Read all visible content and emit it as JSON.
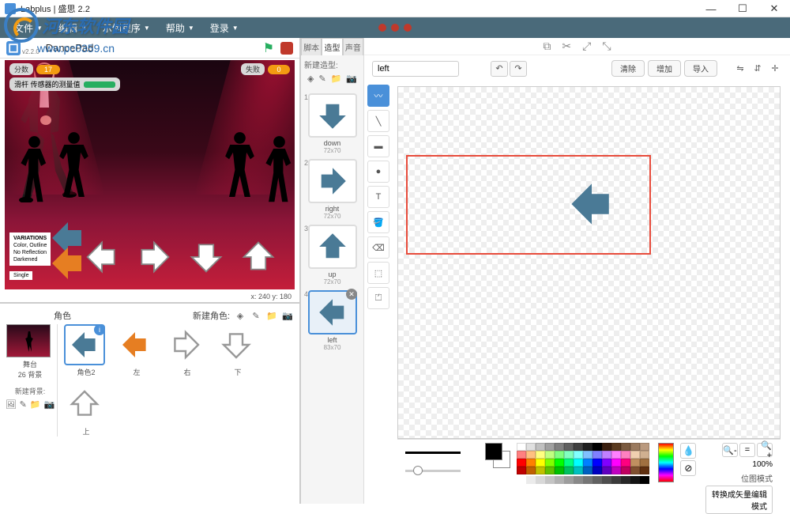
{
  "window": {
    "title": "Labplus | 盛思 2.2"
  },
  "watermark": {
    "text": "河东软件园",
    "url": "www.pc0359.cn"
  },
  "menubar": {
    "items": [
      "文件",
      "编辑",
      "示例程序",
      "帮助",
      "登录"
    ]
  },
  "stage": {
    "version": "v2.2.0",
    "project_name": "DancePad",
    "score_label": "分数",
    "score_value": "17",
    "fail_label": "失败",
    "fail_value": "0",
    "monitor_label": "滑杆 传感器的测量值",
    "variations_title": "VARIATIONS",
    "variations_lines": "Color, Outline\nNo Reflection\nDarkened",
    "single_label": "Single",
    "coords": "x: 240 y: 180"
  },
  "sprites": {
    "label": "角色",
    "new_label": "新建角色:",
    "stage_label": "舞台",
    "stage_caption": "26 背景",
    "new_bg_label": "新建背景:",
    "items": [
      {
        "name": "角色2",
        "color": "#4a7a96",
        "dir": "left",
        "selected": true
      },
      {
        "name": "左",
        "color": "#e67e22",
        "dir": "left"
      },
      {
        "name": "右",
        "color": "#ffffff",
        "dir": "right",
        "stroke": "#999"
      },
      {
        "name": "下",
        "color": "#ffffff",
        "dir": "down",
        "stroke": "#999"
      },
      {
        "name": "上",
        "color": "#ffffff",
        "dir": "up",
        "stroke": "#999"
      }
    ]
  },
  "tabs": {
    "scripts": "脚本",
    "costumes": "造型",
    "sounds": "声音"
  },
  "costumes": {
    "new_label": "新建造型:",
    "items": [
      {
        "idx": "1",
        "name": "down",
        "dim": "72x70",
        "dir": "down"
      },
      {
        "idx": "2",
        "name": "right",
        "dim": "72x70",
        "dir": "right"
      },
      {
        "idx": "3",
        "name": "up",
        "dim": "72x70",
        "dir": "up"
      },
      {
        "idx": "4",
        "name": "left",
        "dim": "83x70",
        "dir": "left",
        "selected": true
      }
    ]
  },
  "editor": {
    "costume_name": "left",
    "btn_clear": "清除",
    "btn_add": "增加",
    "btn_import": "导入",
    "zoom_pct": "100%",
    "mode_label": "位图模式",
    "convert_label": "转换成矢量编辑模式"
  },
  "palette_colors": [
    "#ffffff",
    "#e0e0e0",
    "#c0c0c0",
    "#a0a0a0",
    "#808080",
    "#606060",
    "#404040",
    "#202020",
    "#000000",
    "#3a1f0f",
    "#5a3a1f",
    "#7a5a3f",
    "#9a7a5f",
    "#ba9a7f",
    "#ff8080",
    "#ffc080",
    "#ffff80",
    "#c0ff80",
    "#80ff80",
    "#80ffc0",
    "#80ffff",
    "#80c0ff",
    "#8080ff",
    "#c080ff",
    "#ff80ff",
    "#ff80c0",
    "#f0d0b0",
    "#d0b090",
    "#ff0000",
    "#ff8000",
    "#ffff00",
    "#80ff00",
    "#00ff00",
    "#00ff80",
    "#00ffff",
    "#0080ff",
    "#0000ff",
    "#8000ff",
    "#ff00ff",
    "#ff0080",
    "#c09060",
    "#a07040",
    "#c00000",
    "#c06000",
    "#c0c000",
    "#60c000",
    "#00c000",
    "#00c060",
    "#00c0c0",
    "#0060c0",
    "#0000c0",
    "#6000c0",
    "#c000c0",
    "#c00060",
    "#805030",
    "#603010"
  ]
}
